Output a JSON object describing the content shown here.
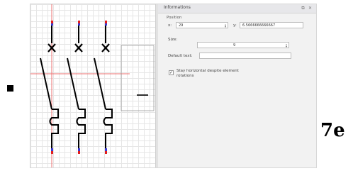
{
  "panel": {
    "title": "Informations",
    "float_icon": "float-icon",
    "close_icon": "close-icon",
    "position_group": "Position",
    "x_label": "x:",
    "x_value": "29",
    "y_label": "y:",
    "y_value": "6.5666666666667",
    "size_label": "Size:",
    "size_value": "9",
    "default_text_label": "Default text:",
    "default_text_value": "",
    "checkbox_label": "Stay horizontal despite element rotations",
    "checkbox_checked": true,
    "checkmark": "✓"
  },
  "schematic": {
    "line_color": "#000000",
    "terminal_red": "#e21d1d",
    "terminal_blue": "#3a3ad6",
    "guide_line_color": "#ee7070"
  },
  "page": {
    "side_label": "7e"
  }
}
